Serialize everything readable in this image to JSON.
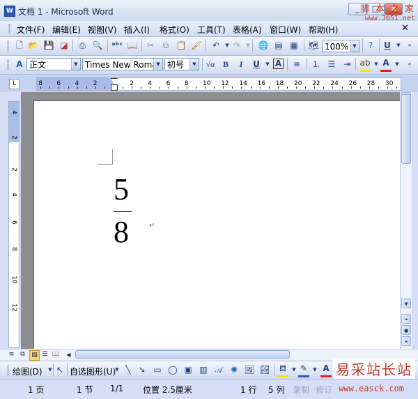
{
  "window": {
    "title": "文档 1 - Microsoft Word",
    "app_icon": "W",
    "min_label": "_",
    "close_label": "✕"
  },
  "watermark_top": {
    "line1": "脚 本 之 家",
    "line2": "www.Jb51.net"
  },
  "watermark_bottom": {
    "line1": "易采站长站",
    "line2": "www.easck.com"
  },
  "menu": {
    "items": [
      "文件(F)",
      "编辑(E)",
      "视图(V)",
      "插入(I)",
      "格式(O)",
      "工具(T)",
      "表格(A)",
      "窗口(W)",
      "帮助(H)"
    ],
    "close_label": "✕"
  },
  "standard_toolbar": {
    "zoom": "100%"
  },
  "format_toolbar": {
    "style": "正文",
    "font": "Times New Roma",
    "size": "初号"
  },
  "ruler": {
    "labels": [
      "8",
      "6",
      "4",
      "2",
      "2",
      "4",
      "6",
      "8",
      "10",
      "12",
      "14",
      "16",
      "18",
      "20",
      "22",
      "24",
      "26",
      "28",
      "30"
    ],
    "tab_selector": "L"
  },
  "vruler": {
    "labels": [
      "4",
      "2",
      "2",
      "4",
      "6",
      "8",
      "10",
      "12"
    ]
  },
  "document": {
    "numerator": "5",
    "denominator": "8",
    "para_mark": "↵"
  },
  "drawbar": {
    "draw_label": "绘图(D)",
    "autoshapes_label": "自选图形(U)"
  },
  "status": {
    "page": "1 页",
    "section": "1 节",
    "pages": "1/1",
    "position": "位置 2.5厘米",
    "line": "1 行",
    "column": "5 列",
    "rec": "录制",
    "trk": "修订"
  }
}
